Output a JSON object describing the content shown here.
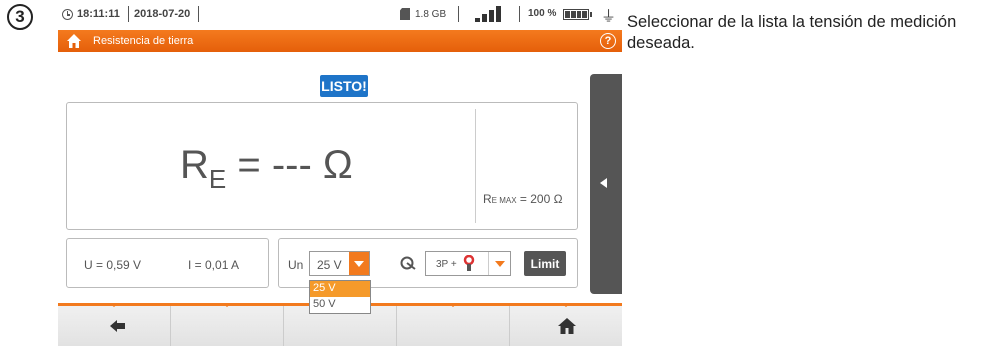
{
  "step": {
    "number": "3"
  },
  "statusbar": {
    "time": "18:11:11",
    "date": "2018-07-20",
    "memory": "1.8 GB",
    "battery_percent": "100 %",
    "signal_level": 1.0,
    "battery_level": 1.0
  },
  "titlebar": {
    "title": "Resistencia de tierra",
    "help_label": "?"
  },
  "status_badge": "LISTO!",
  "result": {
    "main_prefix": "R",
    "main_sub": "E",
    "main_value": " = --- Ω",
    "max_prefix": "R",
    "max_sub": "E MAX",
    "max_value": " = 200 Ω"
  },
  "readings": {
    "u": "U = 0,59 V",
    "i": "I = 0,01 A"
  },
  "settings": {
    "un_label": "Un",
    "un_value": "25 V",
    "un_options": [
      "25 V",
      "50 V"
    ],
    "method_value": "3P +",
    "limit_label": "Limit"
  },
  "bottom_bar": {
    "items": [
      "back",
      "",
      "",
      "",
      "home"
    ]
  },
  "instruction": "Seleccionar de la lista la tensión de medición deseada.",
  "colors": {
    "accent": "#f27a1e",
    "badge": "#1e74c8",
    "side_tab": "#555555"
  }
}
